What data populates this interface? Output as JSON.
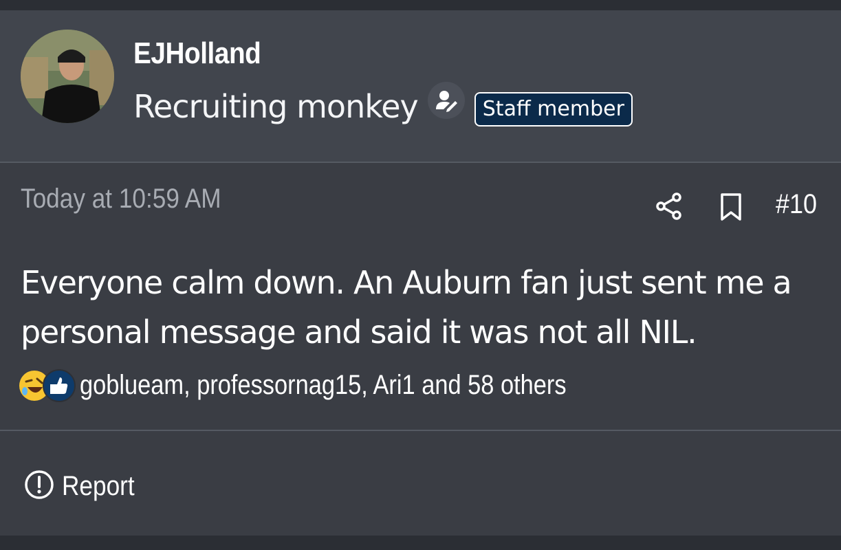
{
  "post": {
    "author": {
      "username": "EJHolland",
      "user_title": "Recruiting monkey",
      "badge": "Staff member"
    },
    "date": "Today at 10:59 AM",
    "post_number": "#10",
    "message": "Everyone calm down. An Auburn fan just sent me a personal message and said it was not all NIL.",
    "reactions": {
      "summary": "goblueam, professornag15, Ari1 and 58 others",
      "icons": [
        "laughing-emoji-icon",
        "thumbs-up-icon"
      ]
    },
    "actions": {
      "report_label": "Report"
    }
  },
  "colors": {
    "background": "#2b2e34",
    "post_background": "#3a3d44",
    "user_block_background": "#41454d",
    "badge_background": "#0b2a4a",
    "muted_text": "#a8acb3",
    "text": "#ffffff"
  }
}
